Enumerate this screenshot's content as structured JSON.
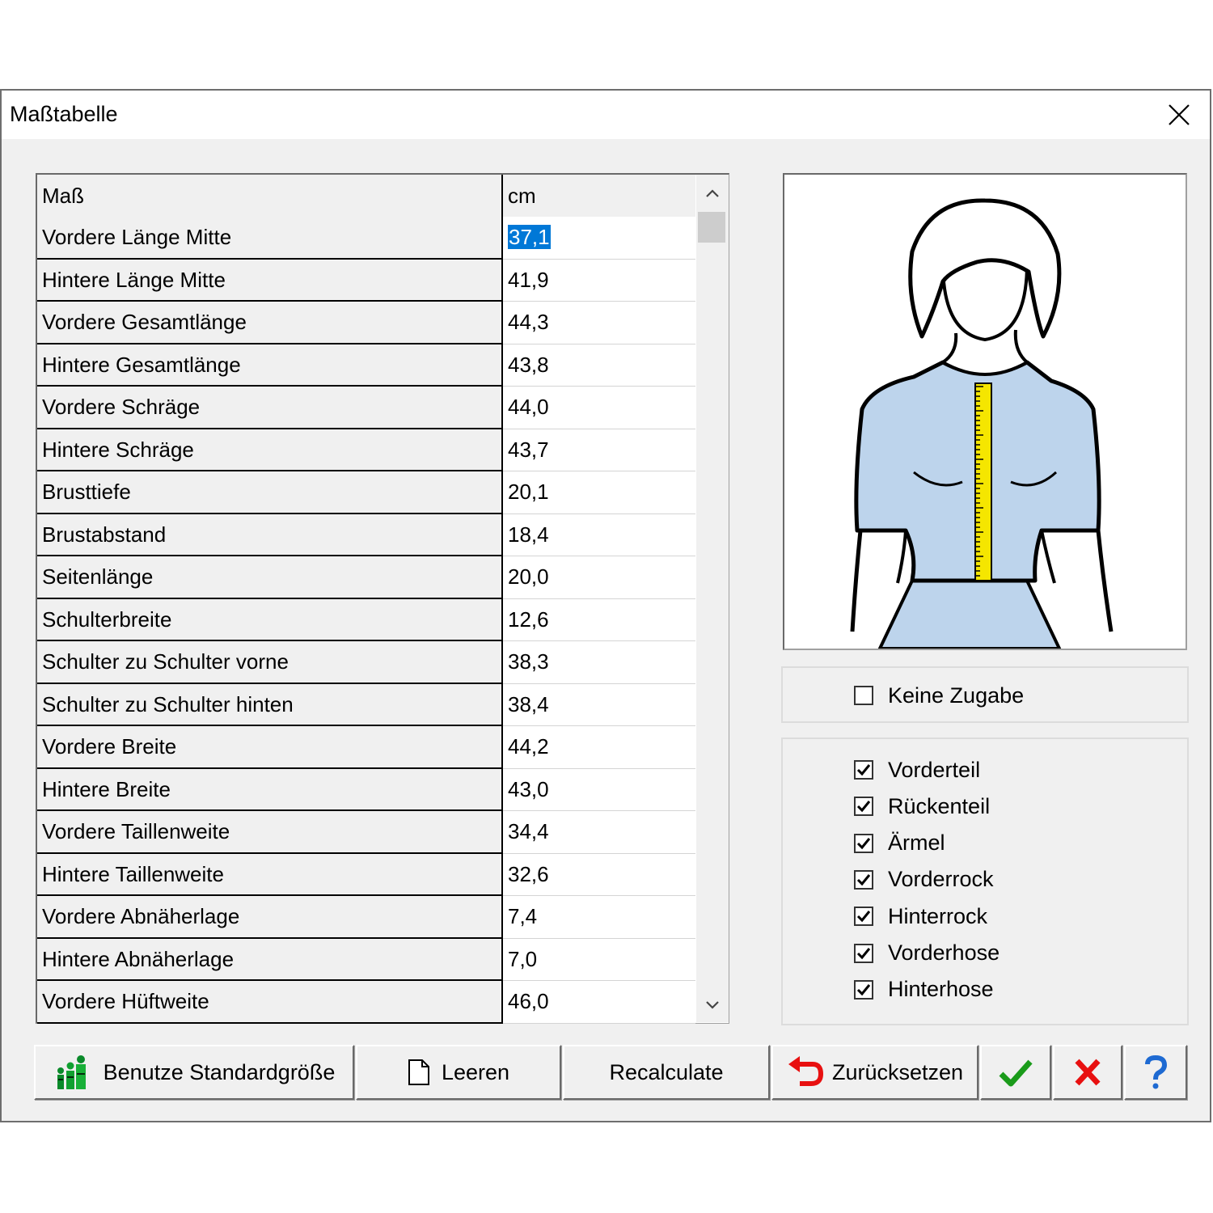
{
  "window": {
    "title": "Maßtabelle"
  },
  "table": {
    "headers": [
      "Maß",
      "cm"
    ],
    "rows": [
      {
        "name": "Vordere Länge Mitte",
        "value": "37,1"
      },
      {
        "name": "Hintere Länge Mitte",
        "value": "41,9"
      },
      {
        "name": "Vordere Gesamtlänge",
        "value": "44,3"
      },
      {
        "name": "Hintere Gesamtlänge",
        "value": "43,8"
      },
      {
        "name": "Vordere Schräge",
        "value": "44,0"
      },
      {
        "name": "Hintere Schräge",
        "value": "43,7"
      },
      {
        "name": "Brusttiefe",
        "value": "20,1"
      },
      {
        "name": "Brustabstand",
        "value": "18,4"
      },
      {
        "name": "Seitenlänge",
        "value": "20,0"
      },
      {
        "name": "Schulterbreite",
        "value": "12,6"
      },
      {
        "name": "Schulter zu Schulter vorne",
        "value": "38,3"
      },
      {
        "name": "Schulter zu Schulter hinten",
        "value": "38,4"
      },
      {
        "name": "Vordere Breite",
        "value": "44,2"
      },
      {
        "name": "Hintere Breite",
        "value": "43,0"
      },
      {
        "name": "Vordere Taillenweite",
        "value": "34,4"
      },
      {
        "name": "Hintere Taillenweite",
        "value": "32,6"
      },
      {
        "name": "Vordere Abnäherlage",
        "value": "7,4"
      },
      {
        "name": "Hintere Abnäherlage",
        "value": "7,0"
      },
      {
        "name": "Vordere Hüftweite",
        "value": "46,0"
      }
    ],
    "selected_row": 0
  },
  "options": {
    "no_allowance": {
      "label": "Keine Zugabe",
      "checked": false
    },
    "parts": [
      {
        "label": "Vorderteil",
        "checked": true
      },
      {
        "label": "Rückenteil",
        "checked": true
      },
      {
        "label": "Ärmel",
        "checked": true
      },
      {
        "label": "Vorderrock",
        "checked": true
      },
      {
        "label": "Hinterrock",
        "checked": true
      },
      {
        "label": "Vorderhose",
        "checked": true
      },
      {
        "label": "Hinterhose",
        "checked": true
      }
    ]
  },
  "buttons": {
    "standard_size": "Benutze Standardgröße",
    "clear": "Leeren",
    "recalculate": "Recalculate",
    "reset": "Zurücksetzen"
  },
  "icons": {
    "standard_size": "people-sizes-icon",
    "clear": "blank-document-icon",
    "reset": "undo-arrow-icon",
    "ok": "green-check-icon",
    "cancel": "red-x-icon",
    "help": "blue-question-icon"
  },
  "colors": {
    "selection": "#0078d7",
    "garment": "#bdd4ec",
    "tape": "#f5e600",
    "ok": "#1a9b1a",
    "cancel": "#e81010",
    "help": "#1e6ad2"
  }
}
